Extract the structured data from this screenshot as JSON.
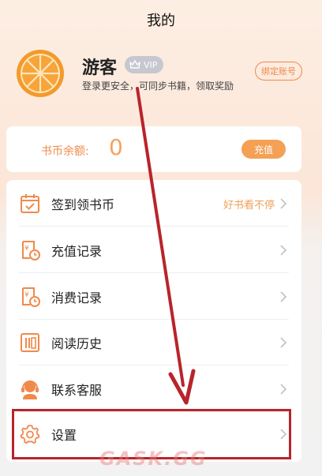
{
  "header": {
    "title": "我的"
  },
  "profile": {
    "username": "游客",
    "vip_label": "VIP",
    "login_hint": "登录更安全，可同步书籍，领取奖励",
    "bind_label": "绑定账号"
  },
  "balance": {
    "label": "书币余额:",
    "value": "0",
    "topup_label": "充值"
  },
  "menu": {
    "items": [
      {
        "label": "签到领书币",
        "extra": "好书看不停",
        "icon": "calendar-check-icon"
      },
      {
        "label": "充值记录",
        "icon": "recharge-record-icon"
      },
      {
        "label": "消费记录",
        "icon": "consume-record-icon"
      },
      {
        "label": "阅读历史",
        "icon": "book-history-icon"
      },
      {
        "label": "联系客服",
        "icon": "headset-icon"
      },
      {
        "label": "设置",
        "icon": "gear-icon"
      }
    ]
  },
  "watermark": "GASK.GG",
  "colors": {
    "accent": "#f08a4b",
    "button": "#f4a055",
    "annotation": "#b8242a"
  }
}
